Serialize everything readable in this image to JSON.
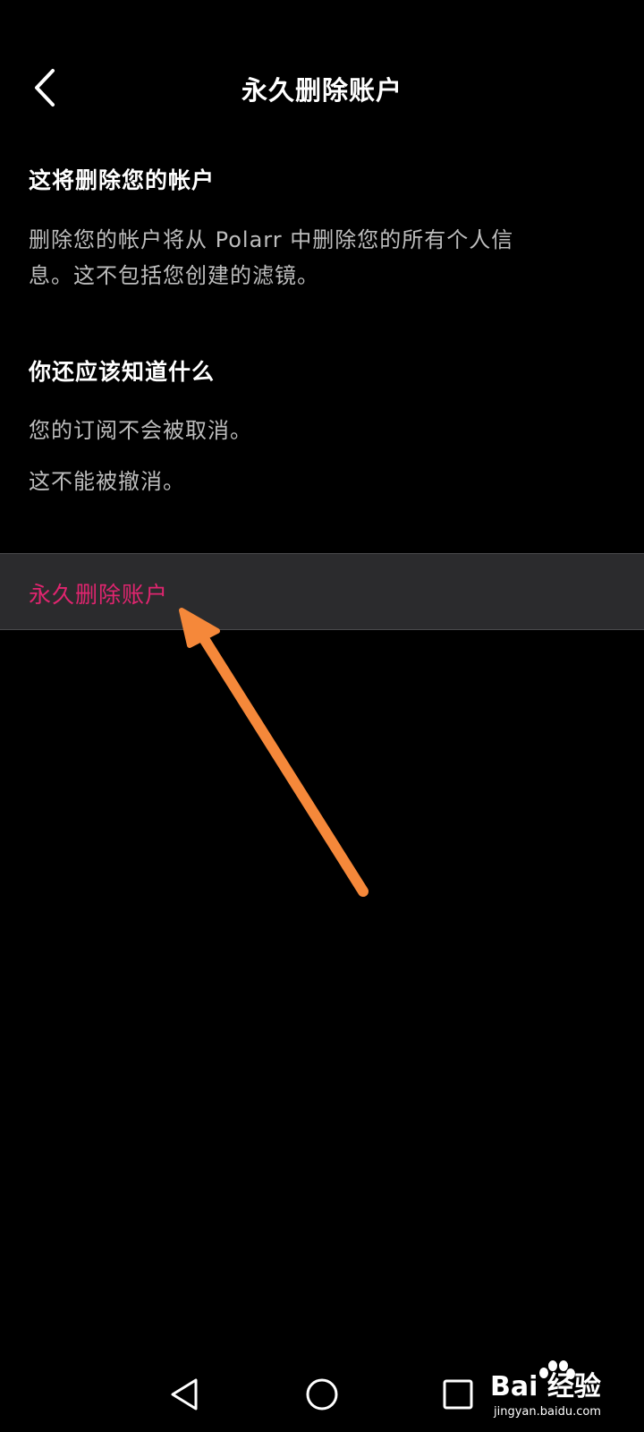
{
  "header": {
    "title": "永久删除账户",
    "back_icon": "chevron-left-icon"
  },
  "section_delete": {
    "title": "这将删除您的帐户",
    "description_line1": "删除您的帐户将从 Polarr 中删除您的所有个人信",
    "description_line2": "息。这不包括您创建的滤镜。"
  },
  "section_know": {
    "title": "你还应该知道什么",
    "line1": "您的订阅不会被取消。",
    "line2": "这不能被撤消。"
  },
  "delete_action": {
    "label": "永久删除账户",
    "color": "#e0256f"
  },
  "nav": {
    "back_icon": "triangle-back-icon",
    "home_icon": "circle-home-icon",
    "recents_icon": "square-recents-icon"
  },
  "watermark": {
    "text": "Bai 经验",
    "url": "jingyan.baidu.com"
  },
  "colors": {
    "background": "#000000",
    "text_primary": "#ffffff",
    "text_secondary": "#bdbdbd",
    "row_background": "#2b2b2d",
    "annotation_arrow": "#f5883a"
  }
}
